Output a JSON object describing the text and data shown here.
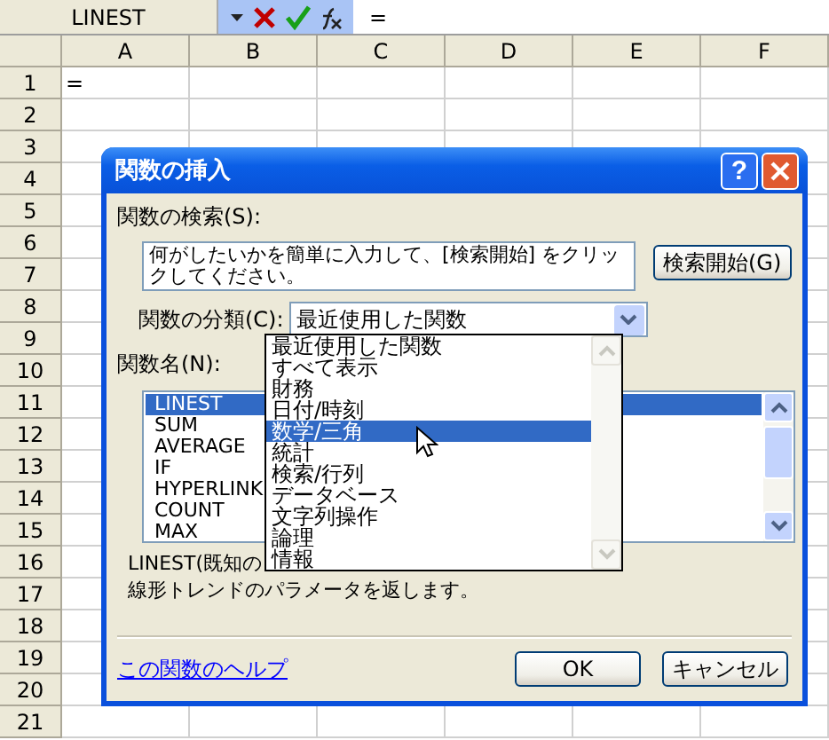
{
  "formula_bar": {
    "name_box": "LINEST",
    "formula": "="
  },
  "sheet": {
    "columns": [
      "A",
      "B",
      "C",
      "D",
      "E",
      "F"
    ],
    "rows": [
      {
        "header": "1",
        "values": [
          "="
        ]
      },
      {
        "header": "2"
      },
      {
        "header": "3"
      },
      {
        "header": "4"
      },
      {
        "header": "5"
      },
      {
        "header": "6"
      },
      {
        "header": "7"
      },
      {
        "header": "8"
      },
      {
        "header": "9"
      },
      {
        "header": "10"
      },
      {
        "header": "11"
      },
      {
        "header": "12"
      },
      {
        "header": "13"
      },
      {
        "header": "14"
      },
      {
        "header": "15"
      },
      {
        "header": "16"
      },
      {
        "header": "17"
      },
      {
        "header": "18"
      },
      {
        "header": "19"
      },
      {
        "header": "20"
      },
      {
        "header": "21"
      }
    ]
  },
  "dialog": {
    "title": "関数の挿入",
    "help_button": "?",
    "search_label": "関数の検索(S):",
    "search_value": "何がしたいかを簡単に入力して、[検索開始] をクリックしてください。",
    "search_button": "検索開始(G)",
    "category_label": "関数の分類(C):",
    "category_value": "最近使用した関数",
    "function_label": "関数名(N):",
    "functions": [
      {
        "label": "LINEST",
        "selected": true
      },
      {
        "label": "SUM",
        "selected": false
      },
      {
        "label": "AVERAGE",
        "selected": false
      },
      {
        "label": "IF",
        "selected": false
      },
      {
        "label": "HYPERLINK",
        "selected": false
      },
      {
        "label": "COUNT",
        "selected": false
      },
      {
        "label": "MAX",
        "selected": false
      }
    ],
    "description": [
      "LINEST(既知の",
      "線形トレンドのパラメータを返します。"
    ],
    "help_link": "この関数のヘルプ",
    "ok_button": "OK",
    "cancel_button": "キャンセル",
    "category_options": [
      {
        "label": "最近使用した関数",
        "selected": false
      },
      {
        "label": "すべて表示",
        "selected": false
      },
      {
        "label": "財務",
        "selected": false
      },
      {
        "label": "日付/時刻",
        "selected": false
      },
      {
        "label": "数学/三角",
        "selected": true
      },
      {
        "label": "統計",
        "selected": false
      },
      {
        "label": "検索/行列",
        "selected": false
      },
      {
        "label": "データベース",
        "selected": false
      },
      {
        "label": "文字列操作",
        "selected": false
      },
      {
        "label": "論理",
        "selected": false
      },
      {
        "label": "情報",
        "selected": false
      }
    ]
  }
}
